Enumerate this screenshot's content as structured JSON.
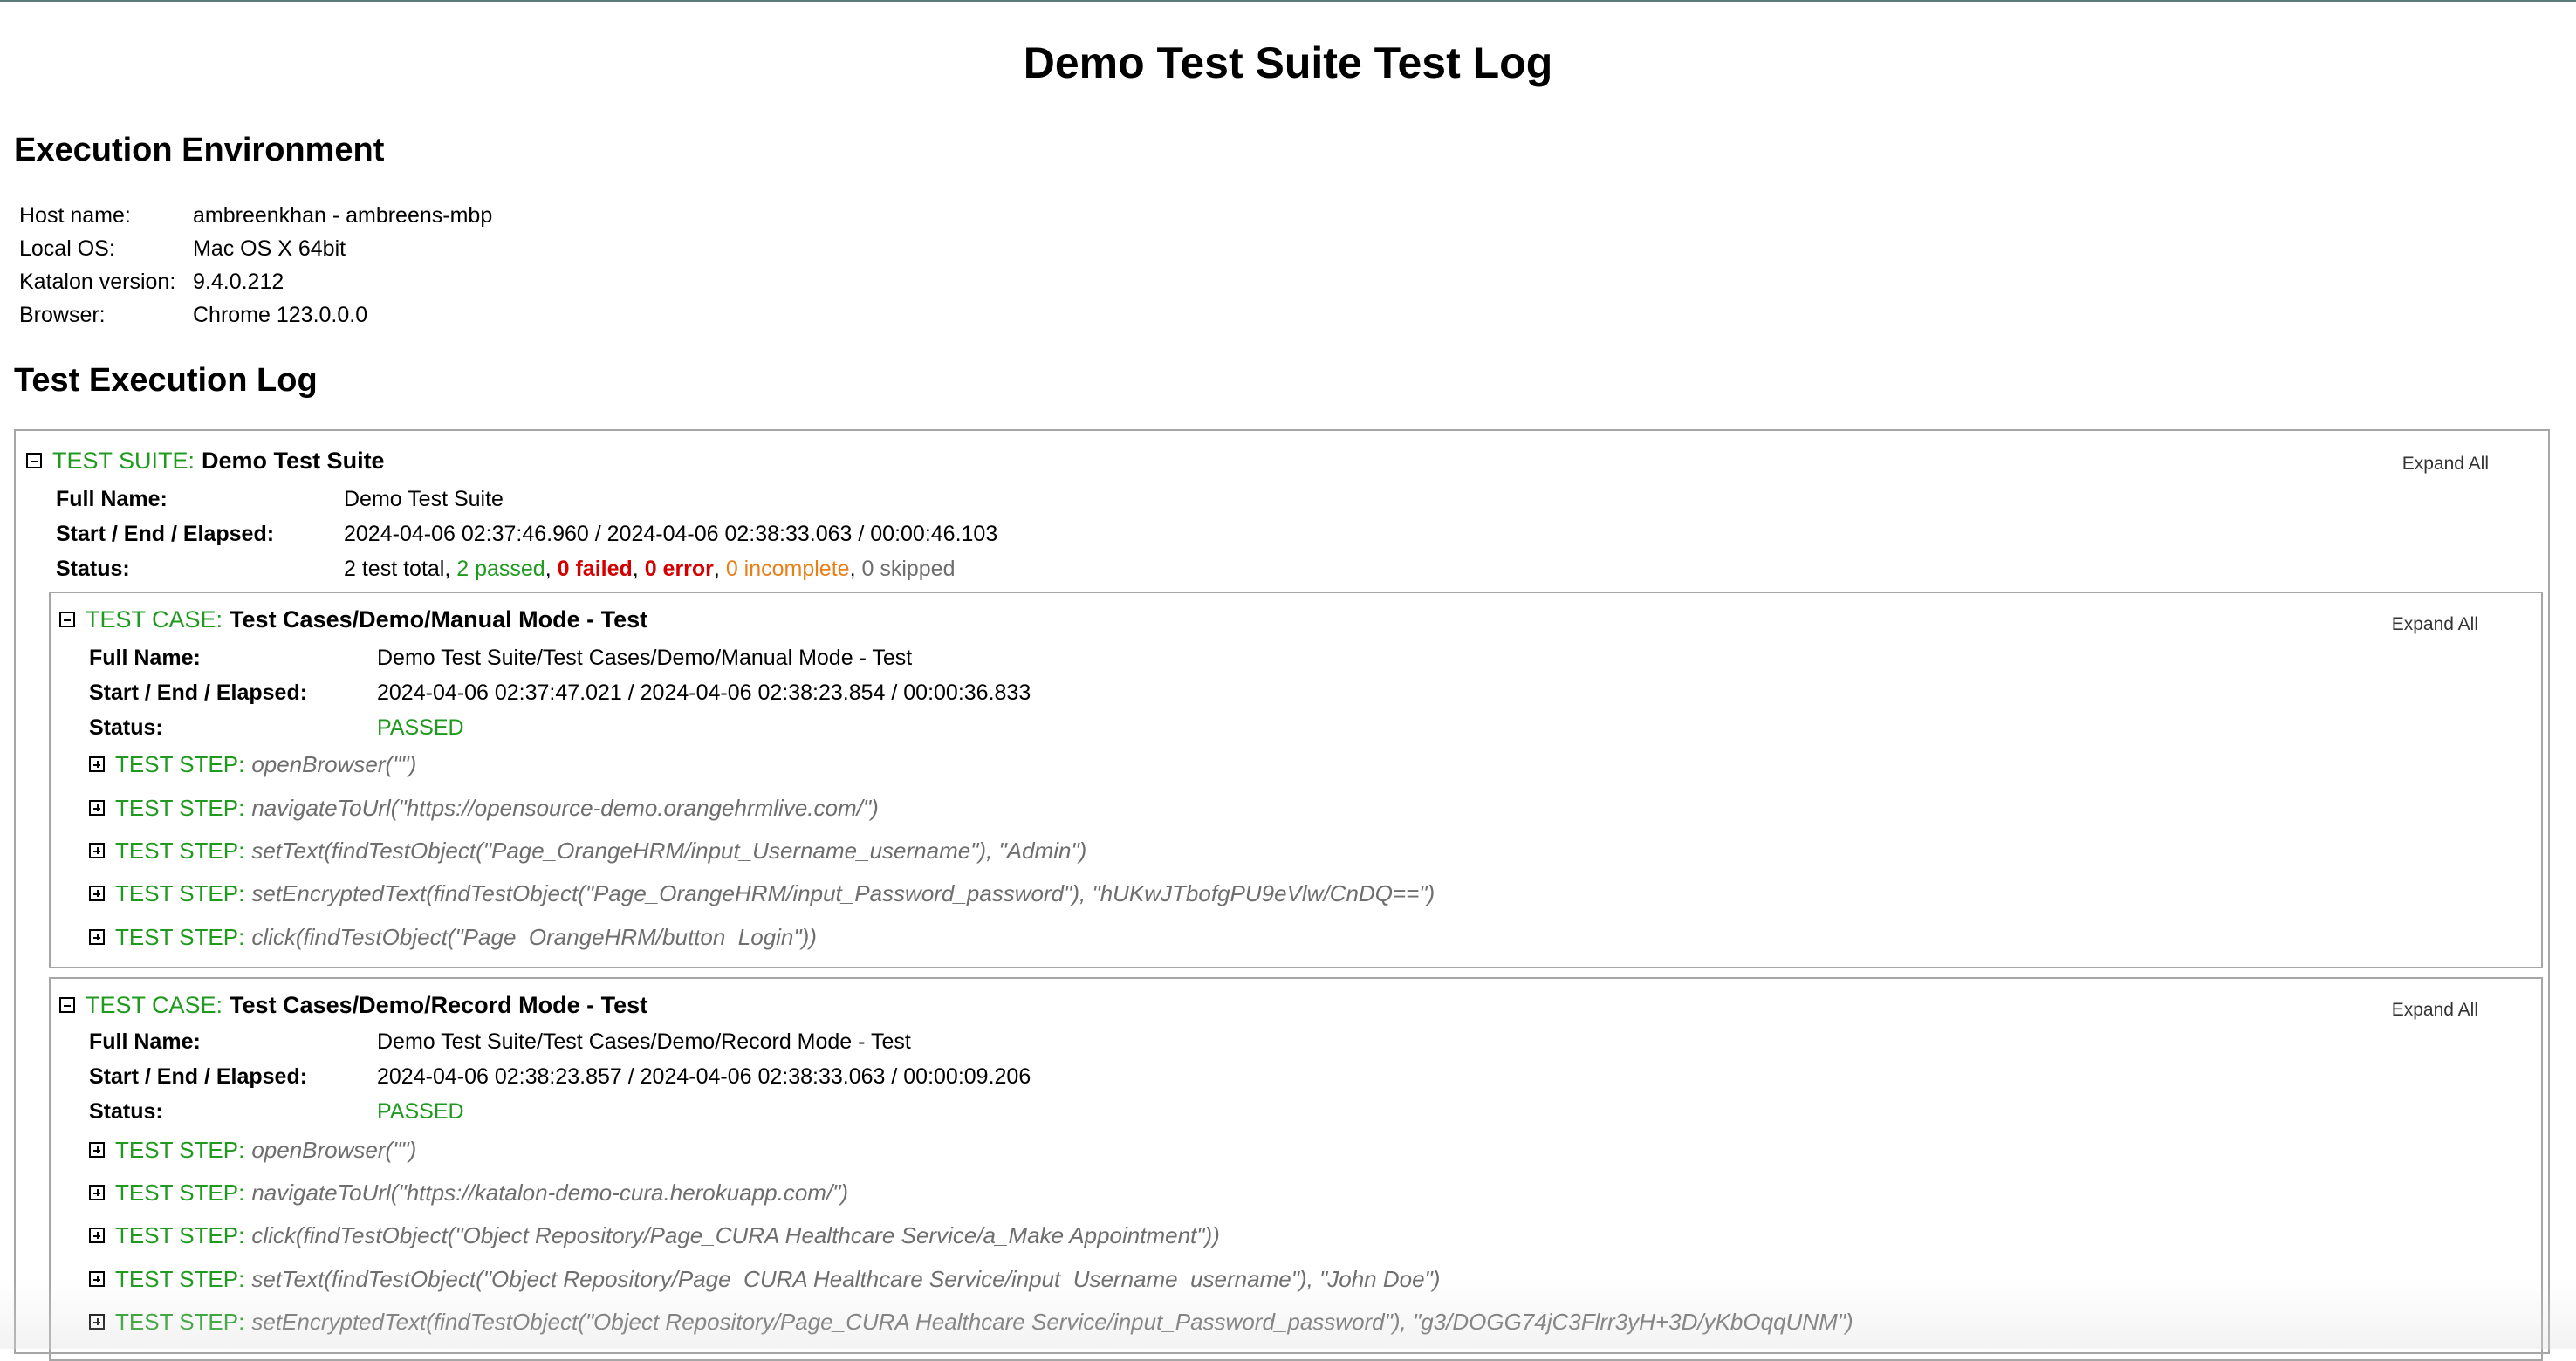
{
  "title": "Demo Test Suite Test Log",
  "environment": {
    "heading": "Execution Environment",
    "rows": [
      {
        "label": "Host name:",
        "value": "ambreenkhan - ambreens-mbp"
      },
      {
        "label": "Local OS:",
        "value": "Mac OS X 64bit"
      },
      {
        "label": "Katalon version:",
        "value": "9.4.0.212"
      },
      {
        "label": "Browser:",
        "value": "Chrome 123.0.0.0"
      }
    ]
  },
  "log_heading": "Test Execution Log",
  "suite": {
    "kind": "TEST SUITE:",
    "name": "Demo Test Suite",
    "expand_label": "Expand All",
    "full_name_label": "Full Name:",
    "full_name": "Demo Test Suite",
    "time_label": "Start / End / Elapsed:",
    "time": "2024-04-06 02:37:46.960 / 2024-04-06 02:38:33.063 / 00:00:46.103",
    "status_label": "Status:",
    "status": {
      "total": "2 test total,",
      "passed": "2 passed",
      "failed": "0 failed",
      "error": "0 error",
      "incomplete": "0 incomplete",
      "skipped": "0 skipped",
      "sep": ","
    }
  },
  "cases": [
    {
      "kind": "TEST CASE:",
      "name": "Test Cases/Demo/Manual Mode - Test",
      "expand_label": "Expand All",
      "full_name_label": "Full Name:",
      "full_name": "Demo Test Suite/Test Cases/Demo/Manual Mode - Test",
      "time_label": "Start / End / Elapsed:",
      "time": "2024-04-06 02:37:47.021 / 2024-04-06 02:38:23.854 / 00:00:36.833",
      "status_label": "Status:",
      "status": "PASSED",
      "steps": [
        {
          "kind": "TEST STEP:",
          "call": "openBrowser(\"\")"
        },
        {
          "kind": "TEST STEP:",
          "call": "navigateToUrl(\"https://opensource-demo.orangehrmlive.com/\")"
        },
        {
          "kind": "TEST STEP:",
          "call": "setText(findTestObject(\"Page_OrangeHRM/input_Username_username\"), \"Admin\")"
        },
        {
          "kind": "TEST STEP:",
          "call": "setEncryptedText(findTestObject(\"Page_OrangeHRM/input_Password_password\"), \"hUKwJTbofgPU9eVlw/CnDQ==\")"
        },
        {
          "kind": "TEST STEP:",
          "call": "click(findTestObject(\"Page_OrangeHRM/button_Login\"))"
        }
      ]
    },
    {
      "kind": "TEST CASE:",
      "name": "Test Cases/Demo/Record Mode - Test",
      "expand_label": "Expand All",
      "full_name_label": "Full Name:",
      "full_name": "Demo Test Suite/Test Cases/Demo/Record Mode - Test",
      "time_label": "Start / End / Elapsed:",
      "time": "2024-04-06 02:38:23.857 / 2024-04-06 02:38:33.063 / 00:00:09.206",
      "status_label": "Status:",
      "status": "PASSED",
      "steps": [
        {
          "kind": "TEST STEP:",
          "call": "openBrowser(\"\")"
        },
        {
          "kind": "TEST STEP:",
          "call": "navigateToUrl(\"https://katalon-demo-cura.herokuapp.com/\")"
        },
        {
          "kind": "TEST STEP:",
          "call": "click(findTestObject(\"Object Repository/Page_CURA Healthcare Service/a_Make Appointment\"))"
        },
        {
          "kind": "TEST STEP:",
          "call": "setText(findTestObject(\"Object Repository/Page_CURA Healthcare Service/input_Username_username\"), \"John Doe\")"
        },
        {
          "kind": "TEST STEP:",
          "call": "setEncryptedText(findTestObject(\"Object Repository/Page_CURA Healthcare Service/input_Password_password\"), \"g3/DOGG74jC3Flrr3yH+3D/yKbOqqUNM\")"
        }
      ]
    }
  ],
  "icons": {
    "collapse": "minus-box-icon",
    "expand": "plus-box-icon"
  },
  "colors": {
    "label_green": "#1f9a1f",
    "failed_red": "#d40000",
    "incomplete_orange": "#e8801a",
    "skipped_gray": "#6e6e6e"
  }
}
